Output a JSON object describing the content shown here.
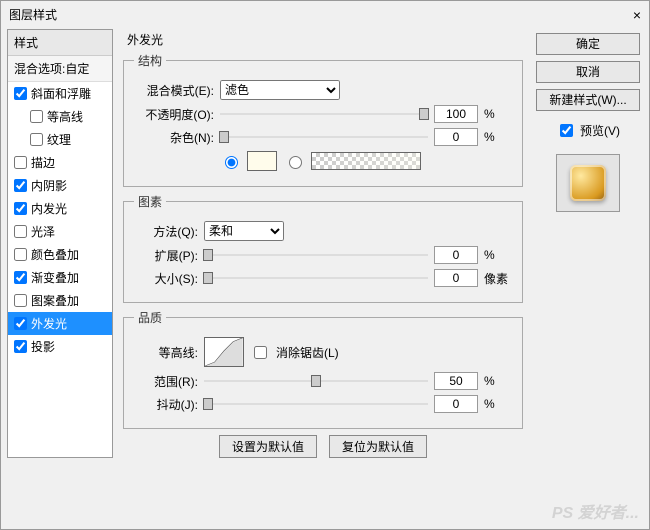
{
  "title": "图层样式",
  "left": {
    "header": "样式",
    "sub": "混合选项:自定",
    "items": [
      {
        "label": "斜面和浮雕",
        "checked": true,
        "indent": false
      },
      {
        "label": "等高线",
        "checked": false,
        "indent": true
      },
      {
        "label": "纹理",
        "checked": false,
        "indent": true
      },
      {
        "label": "描边",
        "checked": false,
        "indent": false
      },
      {
        "label": "内阴影",
        "checked": true,
        "indent": false
      },
      {
        "label": "内发光",
        "checked": true,
        "indent": false
      },
      {
        "label": "光泽",
        "checked": false,
        "indent": false
      },
      {
        "label": "颜色叠加",
        "checked": false,
        "indent": false
      },
      {
        "label": "渐变叠加",
        "checked": true,
        "indent": false
      },
      {
        "label": "图案叠加",
        "checked": false,
        "indent": false
      },
      {
        "label": "外发光",
        "checked": true,
        "indent": false,
        "selected": true
      },
      {
        "label": "投影",
        "checked": true,
        "indent": false
      }
    ]
  },
  "center": {
    "title": "外发光",
    "structure": {
      "legend": "结构",
      "blend_label": "混合模式(E):",
      "blend_value": "滤色",
      "opacity_label": "不透明度(O):",
      "opacity_value": "100",
      "opacity_unit": "%",
      "noise_label": "杂色(N):",
      "noise_value": "0",
      "noise_unit": "%"
    },
    "elements": {
      "legend": "图素",
      "method_label": "方法(Q):",
      "method_value": "柔和",
      "spread_label": "扩展(P):",
      "spread_value": "0",
      "spread_unit": "%",
      "size_label": "大小(S):",
      "size_value": "0",
      "size_unit": "像素"
    },
    "quality": {
      "legend": "品质",
      "contour_label": "等高线:",
      "antialias_label": "消除锯齿(L)",
      "range_label": "范围(R):",
      "range_value": "50",
      "range_unit": "%",
      "jitter_label": "抖动(J):",
      "jitter_value": "0",
      "jitter_unit": "%"
    },
    "defaults": {
      "set": "设置为默认值",
      "reset": "复位为默认值"
    }
  },
  "right": {
    "ok": "确定",
    "cancel": "取消",
    "new_style": "新建样式(W)...",
    "preview": "预览(V)"
  },
  "watermark": "PS 爱好者..."
}
